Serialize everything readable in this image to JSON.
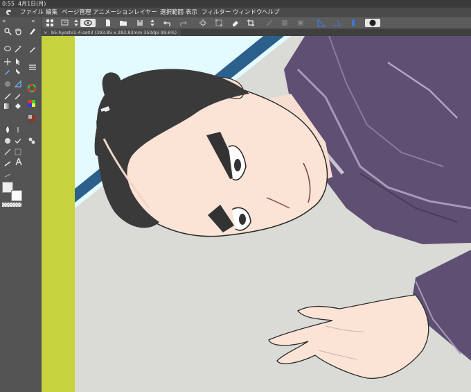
{
  "status": {
    "time": "0:55",
    "date": "4月1日(月)"
  },
  "menu": [
    {
      "label": "ファイル"
    },
    {
      "label": "編集"
    },
    {
      "label": "ページ管理"
    },
    {
      "label": "アニメーション"
    },
    {
      "label": "レイヤー"
    },
    {
      "label": "選択範囲"
    },
    {
      "label": "表示"
    },
    {
      "label": "フィルター"
    },
    {
      "label": "ウィンドウ"
    },
    {
      "label": "ヘルプ"
    }
  ],
  "panel": {
    "collapse_left": "«",
    "collapse_right": "«"
  },
  "tab": {
    "close": "×",
    "title": "b5-hyoshi1-4-se03 (393.85 x 283.83mm 350dpi 99.6%)"
  },
  "toolbar": {
    "help": "?"
  },
  "colors": {
    "app_bg": "#5a5a5a",
    "menubar": "#4a4a4a",
    "panel": "#545454",
    "canvas_floor": "#dadad6",
    "sky": "#e3fbff",
    "accent_blue": "#2b5f8c",
    "lime_strip": "#c6d33c",
    "kimono": "#5f4f72",
    "skin": "#fbe4d6",
    "hair": "#3a3a3a"
  }
}
